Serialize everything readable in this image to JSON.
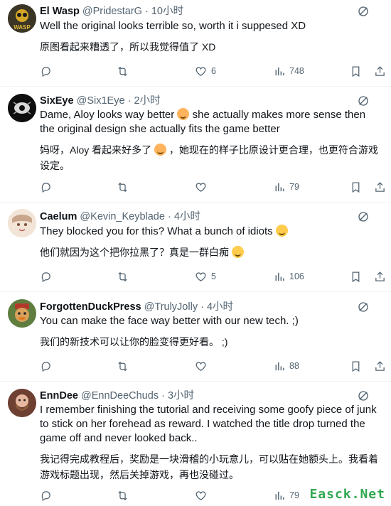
{
  "tweets": [
    {
      "name": "El Wasp",
      "handle": "@PridestarG",
      "dot": "·",
      "time": "10小时",
      "text": "Well the original looks terrible so, worth it i suppesed XD",
      "translation": "原图看起来糟透了，所以我觉得值了 XD",
      "likes": "6",
      "views": "748",
      "replies": "",
      "reposts": ""
    },
    {
      "name": "SixEye",
      "handle": "@Six1Eye",
      "dot": "·",
      "time": "2小时",
      "text_a": "Dame, Aloy looks way better",
      "text_b": "she actually makes more sense then the original design she actually fits the game better",
      "translation_a": "妈呀，Aloy 看起来好多了",
      "translation_b": "，她现在的样子比原设计更合理，也更符合游戏设定。",
      "likes": "",
      "views": "79"
    },
    {
      "name": "Caelum",
      "handle": "@Kevin_Keyblade",
      "dot": "·",
      "time": "4小时",
      "text": "They blocked you for this? What a bunch of idiots",
      "translation": "他们就因为这个把你拉黑了？真是一群白痴",
      "likes": "5",
      "views": "106"
    },
    {
      "name": "ForgottenDuckPress",
      "handle": "@TrulyJolly",
      "dot": "·",
      "time": "4小时",
      "text": "You can make the face way better with our new tech. ;)",
      "translation": "我们的新技术可以让你的脸变得更好看。 ;)",
      "likes": "",
      "views": "88"
    },
    {
      "name": "EnnDee",
      "handle": "@EnnDeeChuds",
      "dot": "·",
      "time": "3小时",
      "text": "I remember finishing the tutorial and receiving some goofy piece of junk to stick on her forehead as reward. I watched the title drop turned the game off and never looked back..",
      "translation": "我记得完成教程后，奖励是一块滑稽的小玩意儿，可以贴在她额头上。我看着游戏标题出现，然后关掉游戏，再也没碰过。",
      "likes": "",
      "views": "79"
    }
  ],
  "avatar_text": "WASP",
  "watermark": "Easck.Net",
  "colors": {
    "text": "#0f1419",
    "secondary": "#536471",
    "divider": "#eff3f4"
  }
}
